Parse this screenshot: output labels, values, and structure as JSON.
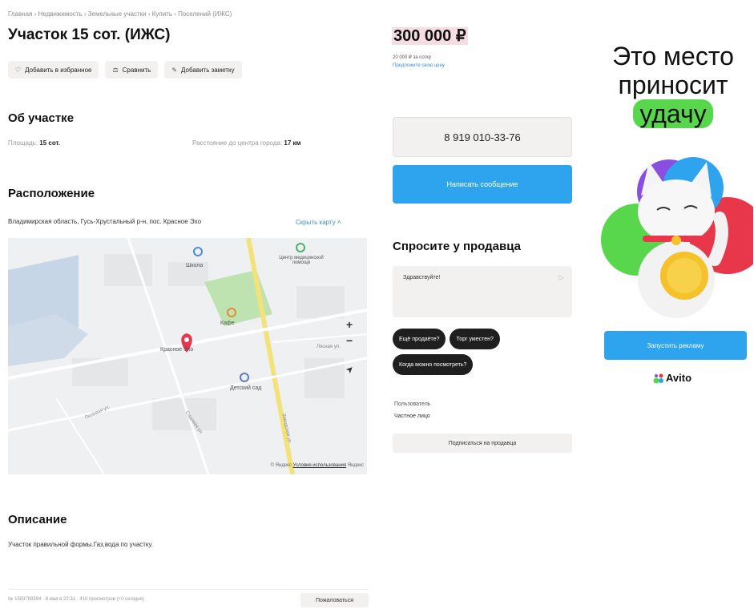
{
  "breadcrumb": "Главная › Недвижимость › Земельные участки › Купить › Поселений (ИЖС)",
  "title": "Участок 15 сот. (ИЖС)",
  "actions": {
    "favorite": "Добавить в избранное",
    "compare": "Сравнить",
    "note": "Добавить заметку"
  },
  "about": {
    "heading": "Об участке",
    "area_label": "Площадь:",
    "area_value": "15 сот.",
    "distance_label": "Расстояние до центра города:",
    "distance_value": "17 км"
  },
  "location": {
    "heading": "Расположение",
    "address": "Владимирская область, Гусь-Хрустальный р-н, пос. Красное Эхо",
    "hide_map": "Скрыть карту",
    "map": {
      "labels": {
        "school": "Школа",
        "kindergarten": "Детский сад",
        "health": "Центр медицинской помощи",
        "cafe": "Кафе",
        "place": "Красное Эхо",
        "street1": "Лесная ул.",
        "street2": "Заводская ул.",
        "street3": "Полевая ул.",
        "street4": "Садовая ул."
      },
      "zoom_in": "+",
      "zoom_out": "−",
      "locate": "➤",
      "copyright": "© Яндекс",
      "terms": "Условия использования",
      "brand": "Яндекс"
    }
  },
  "description": {
    "heading": "Описание",
    "text": "Участок правильной формы.Газ,вода по участку."
  },
  "footer": {
    "meta": "№ 1583798594 · 8 мая в 22:31 · 410 просмотров (+0 сегодня)",
    "report": "Пожаловаться"
  },
  "price": {
    "value": "300 000 ₽",
    "per_are": "20 000 ₽ за сотку",
    "offer": "Предложите свою цену"
  },
  "contact": {
    "phone": "8 919 010-33-76",
    "message": "Написать сообщение"
  },
  "ask": {
    "heading": "Спросите у продавца",
    "input_value": "Здравствуйте!",
    "chips": [
      "Ещё продаёте?",
      "Торг уместен?",
      "Когда можно посмотреть?"
    ]
  },
  "seller": {
    "role": "Пользователь",
    "type": "Частное лицо",
    "subscribe": "Подписаться на продавца"
  },
  "ad": {
    "line1": "Это место",
    "line2": "приносит",
    "line3": "удачу",
    "cta": "Запустить рекламу",
    "logo": "Avito"
  },
  "colors": {
    "accent_blue": "#2fa4ee",
    "link_blue": "#3d8ed8",
    "price_highlight": "#f6dce3",
    "ad_green": "#58d64c"
  }
}
